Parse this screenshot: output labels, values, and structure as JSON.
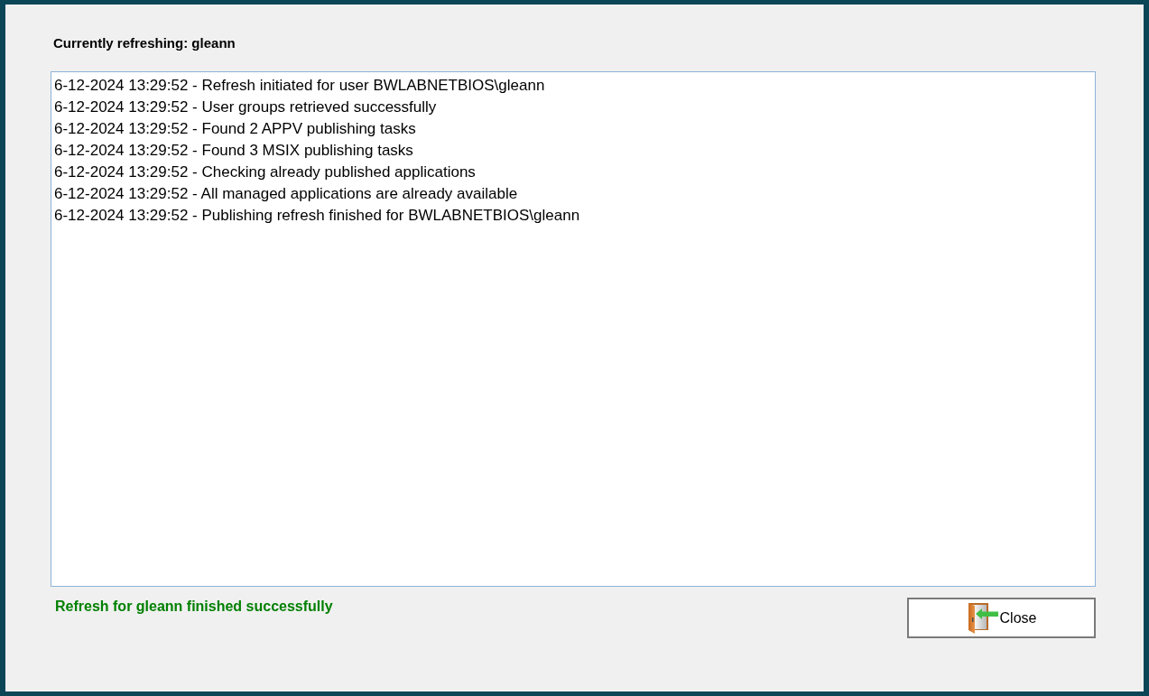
{
  "header": {
    "label": "Currently refreshing: gleann"
  },
  "log": {
    "lines": [
      "6-12-2024 13:29:52 - Refresh initiated for user BWLABNETBIOS\\gleann",
      "6-12-2024 13:29:52 - User groups retrieved successfully",
      "6-12-2024 13:29:52 - Found 2 APPV publishing tasks",
      "6-12-2024 13:29:52 - Found 3 MSIX publishing tasks",
      "6-12-2024 13:29:52 - Checking already published applications",
      "6-12-2024 13:29:52 - All managed applications are already available",
      "6-12-2024 13:29:52 - Publishing refresh finished for BWLABNETBIOS\\gleann"
    ]
  },
  "status": {
    "message": "Refresh for gleann finished successfully",
    "kind": "success"
  },
  "buttons": [
    {
      "label": "Close",
      "kind": "close"
    }
  ]
}
